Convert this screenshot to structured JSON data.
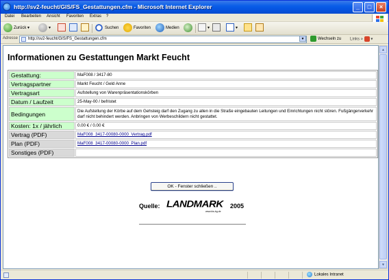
{
  "window": {
    "title": "http://sv2-feucht/GIS/FS_Gestattungen.cfm - Microsoft Internet Explorer",
    "minimize_glyph": "_",
    "maximize_glyph": "□",
    "close_glyph": "×"
  },
  "menu": [
    "Datei",
    "Bearbeiten",
    "Ansicht",
    "Favoriten",
    "Extras",
    "?"
  ],
  "toolbar": {
    "back": "Zurück",
    "search": "Suchen",
    "favorites": "Favoriten",
    "media": "Medien"
  },
  "address": {
    "label": "Adresse",
    "url": "http://sv2-feucht/GIS/FS_Gestattungen.cfm",
    "go_label": "Wechseln zu",
    "links_label": "Links"
  },
  "page": {
    "title": "Informationen zu Gestattungen Markt Feucht",
    "rows": [
      {
        "label": "Gestattung:",
        "value": "MaF008 / 3417-80",
        "grey": false
      },
      {
        "label": "Vertragspartner",
        "value": "Markt Feucht / Geld Anne",
        "grey": false
      },
      {
        "label": "Vertragsart",
        "value": "Aufstellung von Warenpräsentationskörben",
        "grey": false
      },
      {
        "label": "Datum / Laufzeit",
        "value": "25-May-00 / befristet",
        "grey": false
      },
      {
        "label": "Bedingungen",
        "value": "Die Aufstellung der Körbe auf dem Gehsteig darf den Zugang zu allen in die Straße eingebauten Leitungen und Einrichtungen nicht stören. Fußgängerverkehr darf nicht behindert werden. Anbringen von Werbeschildern nicht gestattet.",
        "grey": false
      },
      {
        "label": "Kosten: 1x / jährlich",
        "value": "0.00 € / 0.00 €",
        "grey": false
      },
      {
        "label": "Vertrag (PDF)",
        "link": "MaF008_3417-00080-0000_Vertrag.pdf",
        "grey": true
      },
      {
        "label": "Plan (PDF)",
        "link": "MaF008_3417-00080-0000_Plan.pdf",
        "grey": true
      },
      {
        "label": "Sonstiges (PDF)",
        "value": "",
        "grey": true
      }
    ],
    "ok_button": "OK - Fenster schließen ..",
    "source_label": "Quelle:",
    "logo_text_a": "LAND",
    "logo_text_b": "MARK",
    "logo_tagline": "www.kis-bg.de",
    "source_year": "2005"
  },
  "status": {
    "zone": "Lokales Intranet"
  },
  "colors": {
    "label_bg": "#ccffcc",
    "label_grey_bg": "#d9d9d9",
    "link": "#00008b"
  }
}
